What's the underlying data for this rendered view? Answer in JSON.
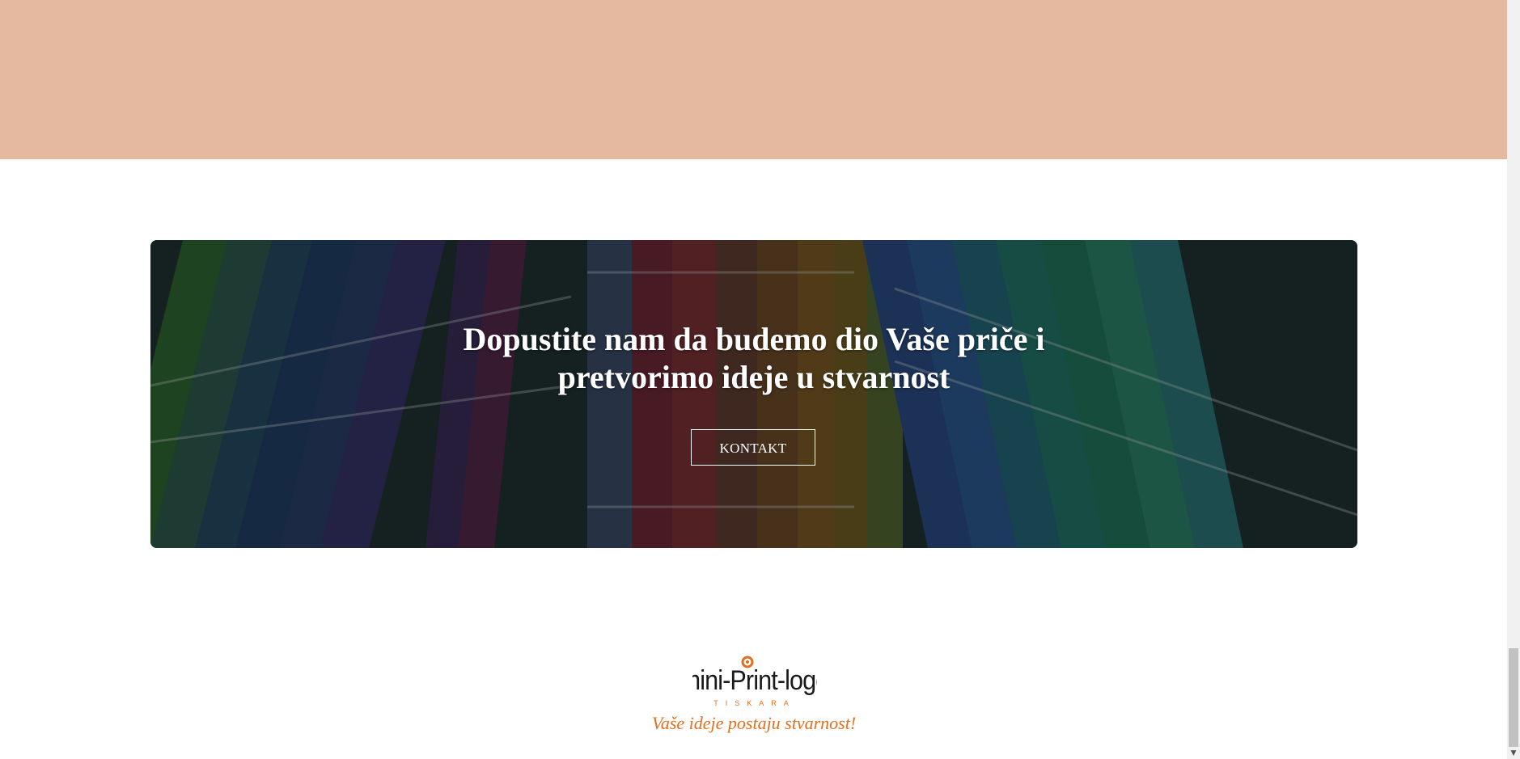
{
  "cta": {
    "heading": "Dopustite nam da budemo dio Vaše priče i pretvorimo ideje u stvarnost",
    "button_label": "KONTAKT"
  },
  "footer": {
    "logo_text": "mini-Print-logo",
    "logo_subtext": "TISKARA",
    "tagline": "Vaše ideje postaju stvarnost!"
  },
  "colors": {
    "hero_band": "#e5b8a0",
    "accent": "#e0701f",
    "cta_text": "#ffffff"
  },
  "icons": {
    "scroll_down": "chevron-down-icon"
  }
}
